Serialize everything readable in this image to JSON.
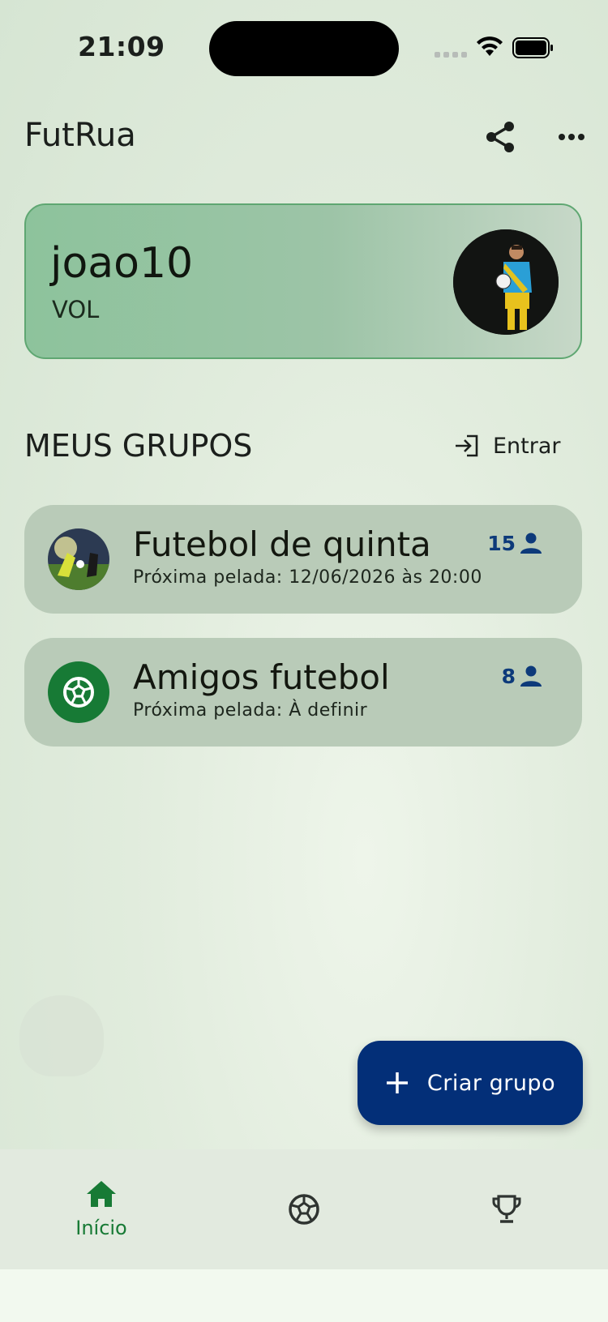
{
  "status_bar": {
    "time": "21:09"
  },
  "app_bar": {
    "title": "FutRua",
    "share_icon": "share-icon",
    "more_icon": "more-horizontal-icon"
  },
  "profile": {
    "username": "joao10",
    "position": "VOL",
    "avatar": "player-photo"
  },
  "groups_section": {
    "title": "MEUS GRUPOS",
    "join_label": "Entrar"
  },
  "groups": [
    {
      "name": "Futebol de quinta",
      "next_match": "Próxima pelada: 12/06/2026 às 20:00",
      "members": "15",
      "avatar": "football-photo"
    },
    {
      "name": "Amigos futebol",
      "next_match": "Próxima pelada: À definir",
      "members": "8",
      "avatar": "soccer-ball-icon"
    }
  ],
  "fab": {
    "label": "Criar grupo",
    "icon": "plus-icon"
  },
  "bottom_nav": [
    {
      "label": "Início",
      "icon": "home-icon",
      "active": true
    },
    {
      "label": "",
      "icon": "soccer-ball-icon",
      "active": false
    },
    {
      "label": "",
      "icon": "trophy-icon",
      "active": false
    }
  ],
  "colors": {
    "primary_green": "#177a35",
    "navy": "#032f78",
    "card_green": "#b9cbb8"
  }
}
